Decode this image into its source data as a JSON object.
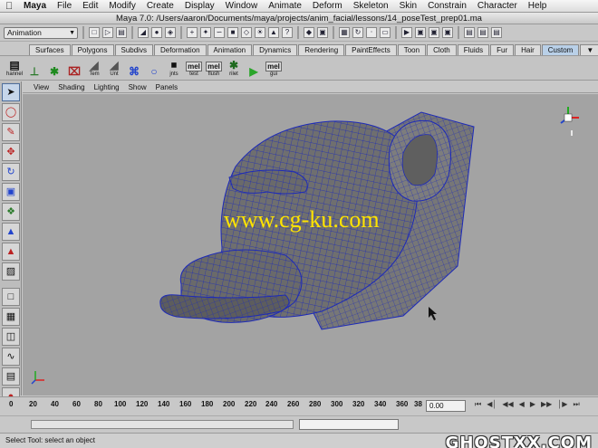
{
  "menubar": {
    "app": "Maya",
    "items": [
      "File",
      "Edit",
      "Modify",
      "Create",
      "Display",
      "Window",
      "Animate",
      "Deform",
      "Skeleton",
      "Skin",
      "Constrain",
      "Character",
      "Help"
    ]
  },
  "window": {
    "title": "Maya 7.0: /Users/aaron/Documents/maya/projects/anim_facial/lessons/14_poseTest_prep01.ma"
  },
  "statusline": {
    "mode_menu": "Animation"
  },
  "shelf": {
    "tabs": [
      "Surfaces",
      "Polygons",
      "Subdivs",
      "Deformation",
      "Animation",
      "Dynamics",
      "Rendering",
      "PaintEffects",
      "Toon",
      "Cloth",
      "Fluids",
      "Fur",
      "Hair",
      "Custom"
    ],
    "active_tab": "Custom",
    "buttons": [
      {
        "icon": "channel-box-icon",
        "label": "hannel"
      },
      {
        "icon": "bake-icon",
        "label": ""
      },
      {
        "icon": "star-icon",
        "label": ""
      },
      {
        "icon": "grid-icon",
        "label": ""
      },
      {
        "icon": "tem-icon",
        "label": "Tem"
      },
      {
        "icon": "unt-icon",
        "label": "Unt"
      },
      {
        "icon": "locator-icon",
        "label": ""
      },
      {
        "icon": "circle-icon",
        "label": ""
      },
      {
        "icon": "joints-icon",
        "label": "jnts"
      },
      {
        "icon": "mel-icon",
        "label": "test"
      },
      {
        "icon": "mel-icon",
        "label": "flush"
      },
      {
        "icon": "star-icon",
        "label": "rilet"
      },
      {
        "icon": "play-icon",
        "label": ""
      },
      {
        "icon": "mel-icon",
        "label": "gui"
      }
    ],
    "mel_text": "mel"
  },
  "panel_menu": [
    "View",
    "Shading",
    "Lighting",
    "Show",
    "Panels"
  ],
  "viewport": {
    "watermark": "www.cg-ku.com"
  },
  "timeslider": {
    "ticks": [
      "20",
      "40",
      "60",
      "80",
      "100",
      "120",
      "140",
      "160",
      "180",
      "200",
      "220",
      "240",
      "260",
      "280",
      "300",
      "320",
      "340",
      "360",
      "38"
    ],
    "first_tick": "0",
    "current_time": "0.00"
  },
  "helpline": {
    "text": "Select Tool: select an object"
  },
  "logo": "GHOSTXX.COM",
  "colors": {
    "mesh_wire": "#1d2ab8",
    "viewport_bg": "#a3a3a3",
    "watermark": "#ffe400"
  }
}
